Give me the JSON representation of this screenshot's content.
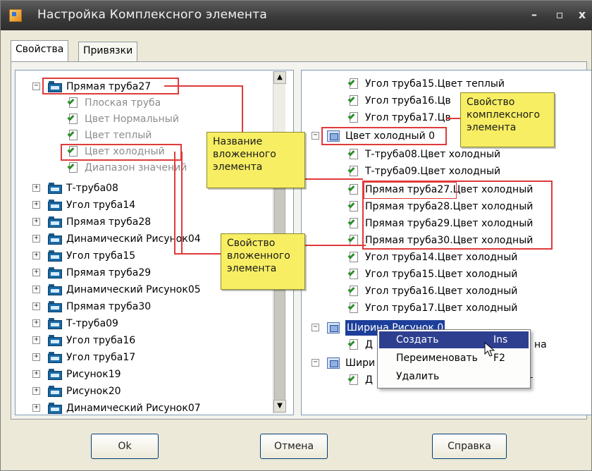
{
  "window": {
    "title": "Настройка Комплексного элемента",
    "controls": {
      "minimize": "–",
      "maximize": "▫",
      "close": "x"
    }
  },
  "tabs": [
    {
      "label": "Свойства"
    },
    {
      "label": "Привязки"
    }
  ],
  "left_tree": {
    "root": "Прямая труба27",
    "children": [
      "Плоская труба",
      "Цвет Нормальный",
      "Цвет теплый",
      "Цвет холодный",
      "Диапазон значений"
    ],
    "items": [
      "Т-труба08",
      "Угол труба14",
      "Прямая труба28",
      "Динамический Рисунок04",
      "Угол труба15",
      "Прямая труба29",
      "Динамический Рисунок05",
      "Прямая труба30",
      "Т-труба09",
      "Угол труба16",
      "Угол труба17",
      "Рисунок19",
      "Рисунок20",
      "Динамический Рисунок07"
    ]
  },
  "right_tree": {
    "top_items": [
      "Угол труба15.Цвет теплый",
      "Угол труба16.Цв",
      "Угол труба17.Цв"
    ],
    "group1": "Цвет холодный 0",
    "group1_items": [
      "Т-труба08.Цвет холодный",
      "Т-труба09.Цвет холодный",
      "Прямая труба27.Цвет холодный",
      "Прямая труба28.Цвет холодный",
      "Прямая труба29.Цвет холодный",
      "Прямая труба30.Цвет холодный",
      "Угол труба14.Цвет холодный",
      "Угол труба15.Цвет холодный",
      "Угол труба16.Цвет холодный",
      "Угол труба17.Цвет холодный"
    ],
    "group2": "Ширина Рисунок 0",
    "group2_child": "Д",
    "group2_tail": "на",
    "group3": "Шири",
    "group3_child": "Д",
    "group3_tail": "т"
  },
  "callouts": {
    "complex_property": "Свойство\nкомплексного\nэлемента",
    "nested_name": "Название\nвложенного\nэлемента",
    "nested_property": "Свойство\nвложенного\nэлемента"
  },
  "context_menu": {
    "items": [
      {
        "label": "Создать",
        "shortcut": "Ins"
      },
      {
        "label": "Переименовать",
        "shortcut": "F2"
      },
      {
        "label": "Удалить",
        "shortcut": ""
      }
    ]
  },
  "buttons": {
    "ok": "Ok",
    "cancel": "Отмена",
    "help": "Справка"
  },
  "colors": {
    "callout_bg": "#f7ee63",
    "highlight_border": "#e03a3a",
    "selection": "#1d3e9a"
  }
}
